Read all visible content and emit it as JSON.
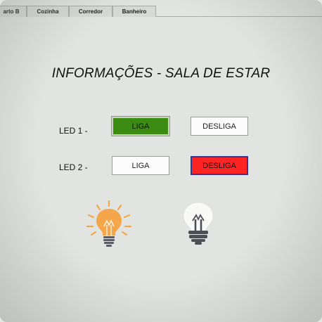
{
  "tabs": [
    {
      "label": "arto B"
    },
    {
      "label": "Cozinha"
    },
    {
      "label": "Corredor"
    },
    {
      "label": "Banheiro"
    }
  ],
  "page_title": "INFORMAÇÕES - SALA DE ESTAR",
  "led1": {
    "label": "LED 1 -",
    "on_label": "LIGA",
    "off_label": "DESLIGA",
    "state": "on"
  },
  "led2": {
    "label": "LED 2 -",
    "on_label": "LIGA",
    "off_label": "DESLIGA",
    "state": "off"
  },
  "colors": {
    "on_active": "#3c8c13",
    "off_active": "#ff2424",
    "bulb_on": "#f6a64a",
    "bulb_off": "#4e4f56"
  },
  "icons": {
    "bulb1": "lightbulb-on-icon",
    "bulb2": "lightbulb-off-icon"
  }
}
